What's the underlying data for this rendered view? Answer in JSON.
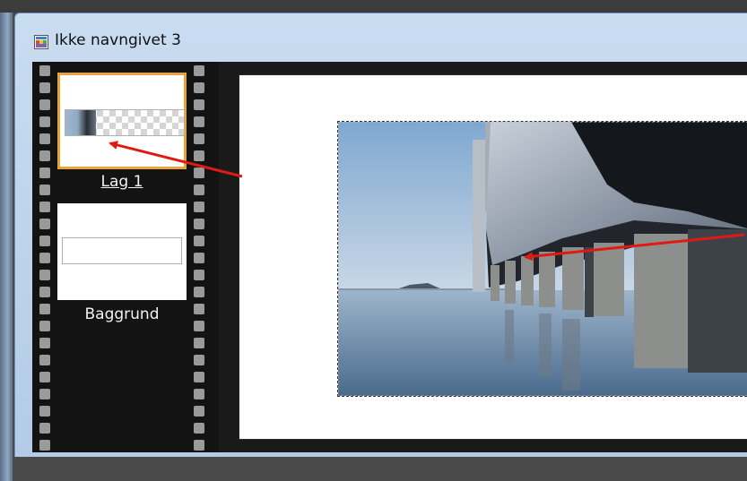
{
  "window": {
    "title": "Ikke navngivet 3"
  },
  "layers": [
    {
      "label": "Lag 1",
      "selected": true,
      "transparent": true
    },
    {
      "label": "Baggrund",
      "selected": false,
      "transparent": false
    }
  ],
  "colors": {
    "selection_border": "#e8a33a",
    "annotation_arrow": "#e01a12",
    "titlebar": "#c9dcf0"
  },
  "icons": {
    "app": "document-image-icon"
  }
}
